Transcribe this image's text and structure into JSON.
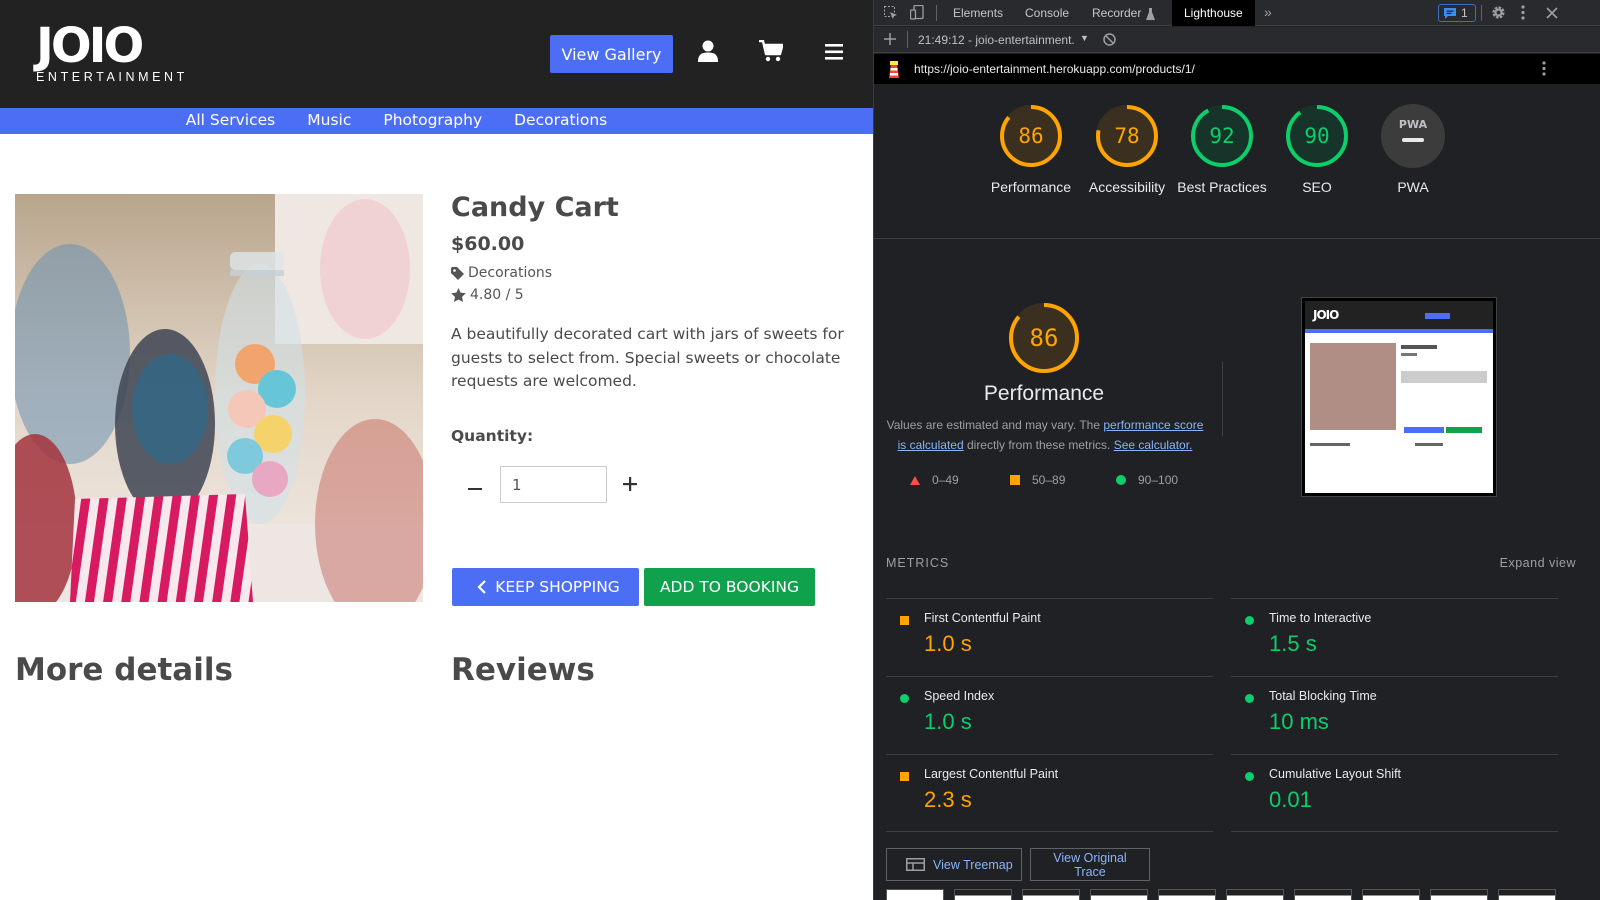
{
  "site": {
    "logo": {
      "main": "JOIO",
      "sub": "ENTERTAINMENT"
    },
    "header": {
      "gallery_button": "View Gallery"
    },
    "nav": [
      "All Services",
      "Music",
      "Photography",
      "Decorations"
    ],
    "product": {
      "title": "Candy Cart",
      "price": "$60.00",
      "category": "Decorations",
      "rating": "4.80 / 5",
      "description": "A beautifully decorated cart with jars of sweets for guests to select from. Special sweets or chocolate requests are welcomed.",
      "quantity_label": "Quantity:",
      "quantity_value": "1",
      "keep_shopping": "KEEP SHOPPING",
      "add_to_booking": "ADD TO BOOKING"
    },
    "sections": {
      "details": "More details",
      "reviews": "Reviews"
    }
  },
  "devtools": {
    "tabs": [
      "Elements",
      "Console",
      "Recorder",
      "Lighthouse"
    ],
    "issues_count": "1",
    "report_select": "21:49:12 - joio-entertainment.",
    "url": "https://joio-entertainment.herokuapp.com/products/1/",
    "scores": [
      {
        "label": "Performance",
        "value": "86",
        "score": 86,
        "color": "#ffa400"
      },
      {
        "label": "Accessibility",
        "value": "78",
        "score": 78,
        "color": "#ffa400"
      },
      {
        "label": "Best Practices",
        "value": "92",
        "score": 92,
        "color": "#0cce6b"
      },
      {
        "label": "SEO",
        "value": "90",
        "score": 90,
        "color": "#0cce6b"
      },
      {
        "label": "PWA",
        "value": "PWA",
        "score": null,
        "color": "#9aa0a6"
      }
    ],
    "performance": {
      "score": "86",
      "title": "Performance",
      "note_start": "Values are estimated and may vary. The ",
      "note_link1": "performance score is calculated",
      "note_mid": " directly from these metrics. ",
      "note_link2": "See calculator.",
      "legend": [
        "0–49",
        "50–89",
        "90–100"
      ]
    },
    "metrics_header": "METRICS",
    "expand_view": "Expand view",
    "metrics": [
      {
        "name": "First Contentful Paint",
        "value": "1.0 s",
        "status": "average"
      },
      {
        "name": "Time to Interactive",
        "value": "1.5 s",
        "status": "pass"
      },
      {
        "name": "Speed Index",
        "value": "1.0 s",
        "status": "pass"
      },
      {
        "name": "Total Blocking Time",
        "value": "10 ms",
        "status": "pass"
      },
      {
        "name": "Largest Contentful Paint",
        "value": "2.3 s",
        "status": "average"
      },
      {
        "name": "Cumulative Layout Shift",
        "value": "0.01",
        "status": "pass"
      }
    ],
    "buttons": {
      "treemap": "View Treemap",
      "trace": "View Original Trace"
    },
    "colors": {
      "pass": "#0cce6b",
      "average": "#ffa400",
      "fail": "#ff4e42"
    }
  }
}
